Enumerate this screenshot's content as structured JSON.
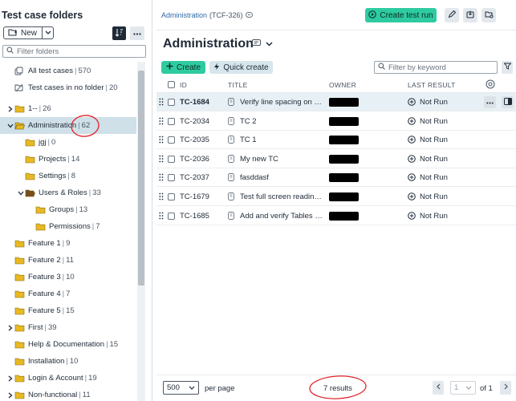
{
  "sidebar": {
    "title": "Test case folders",
    "new_label": "New",
    "filter_placeholder": "Filter folders",
    "items": [
      {
        "label": "All test cases",
        "count": "570",
        "depth": 0,
        "icon": "all-cases",
        "twisty": "none"
      },
      {
        "label": "Test cases in no folder",
        "count": "20",
        "depth": 0,
        "icon": "no-folder",
        "twisty": "none"
      },
      {
        "label": "1--",
        "count": "26",
        "depth": 0,
        "icon": "folder",
        "twisty": "right"
      },
      {
        "label": "Administration",
        "count": "62",
        "depth": 0,
        "icon": "folder-open",
        "twisty": "down",
        "selected": true
      },
      {
        "label": "jgj",
        "count": "0",
        "depth": 1,
        "icon": "folder",
        "twisty": "none"
      },
      {
        "label": "Projects",
        "count": "14",
        "depth": 1,
        "icon": "folder",
        "twisty": "none"
      },
      {
        "label": "Settings",
        "count": "8",
        "depth": 1,
        "icon": "folder",
        "twisty": "none"
      },
      {
        "label": "Users & Roles",
        "count": "33",
        "depth": 1,
        "icon": "folder-open-dark",
        "twisty": "down"
      },
      {
        "label": "Groups",
        "count": "13",
        "depth": 2,
        "icon": "folder",
        "twisty": "none"
      },
      {
        "label": "Permissions",
        "count": "7",
        "depth": 2,
        "icon": "folder",
        "twisty": "none"
      },
      {
        "label": "Feature 1",
        "count": "9",
        "depth": 0,
        "icon": "folder",
        "twisty": "none"
      },
      {
        "label": "Feature 2",
        "count": "11",
        "depth": 0,
        "icon": "folder",
        "twisty": "none"
      },
      {
        "label": "Feature 3",
        "count": "10",
        "depth": 0,
        "icon": "folder",
        "twisty": "none"
      },
      {
        "label": "Feature 4",
        "count": "7",
        "depth": 0,
        "icon": "folder",
        "twisty": "none"
      },
      {
        "label": "Feature 5",
        "count": "15",
        "depth": 0,
        "icon": "folder",
        "twisty": "none"
      },
      {
        "label": "First",
        "count": "39",
        "depth": 0,
        "icon": "folder",
        "twisty": "right"
      },
      {
        "label": "Help & Documentation",
        "count": "15",
        "depth": 0,
        "icon": "folder",
        "twisty": "none"
      },
      {
        "label": "Installation",
        "count": "10",
        "depth": 0,
        "icon": "folder",
        "twisty": "none"
      },
      {
        "label": "Login & Account",
        "count": "19",
        "depth": 0,
        "icon": "folder",
        "twisty": "right"
      },
      {
        "label": "Non-functional",
        "count": "11",
        "depth": 0,
        "icon": "folder",
        "twisty": "right"
      }
    ]
  },
  "breadcrumb": {
    "link": "Administration",
    "id": "(TCF-326)"
  },
  "toolbar": {
    "create_run_label": "Create test run"
  },
  "page_title": "Administration",
  "actions": {
    "create_label": "Create",
    "quick_create_label": "Quick create",
    "keyword_placeholder": "Filter by keyword"
  },
  "table": {
    "columns": [
      "ID",
      "TITLE",
      "OWNER",
      "LAST RESULT"
    ],
    "rows": [
      {
        "id": "TC-1684",
        "title": "Verify line spacing on menu items",
        "status": "Not Run",
        "hover": true
      },
      {
        "id": "TC-2034",
        "title": "TC 2",
        "status": "Not Run"
      },
      {
        "id": "TC-2035",
        "title": "TC 1",
        "status": "Not Run"
      },
      {
        "id": "TC-2036",
        "title": "My new TC",
        "status": "Not Run"
      },
      {
        "id": "TC-2037",
        "title": "fasddasf",
        "status": "Not Run"
      },
      {
        "id": "TC-1679",
        "title": "Test full screen reading mode",
        "status": "Not Run"
      },
      {
        "id": "TC-1685",
        "title": "Add and verify Tables of contents",
        "status": "Not Run"
      }
    ]
  },
  "footer": {
    "page_size": "500",
    "per_page_label": "per page",
    "results": "7 results",
    "page": "1",
    "of_label": "of 1"
  },
  "colors": {
    "accent": "#2ecba0",
    "selected": "#cfe0e8",
    "folder": "#e8b923",
    "annotation": "#e0242b"
  }
}
